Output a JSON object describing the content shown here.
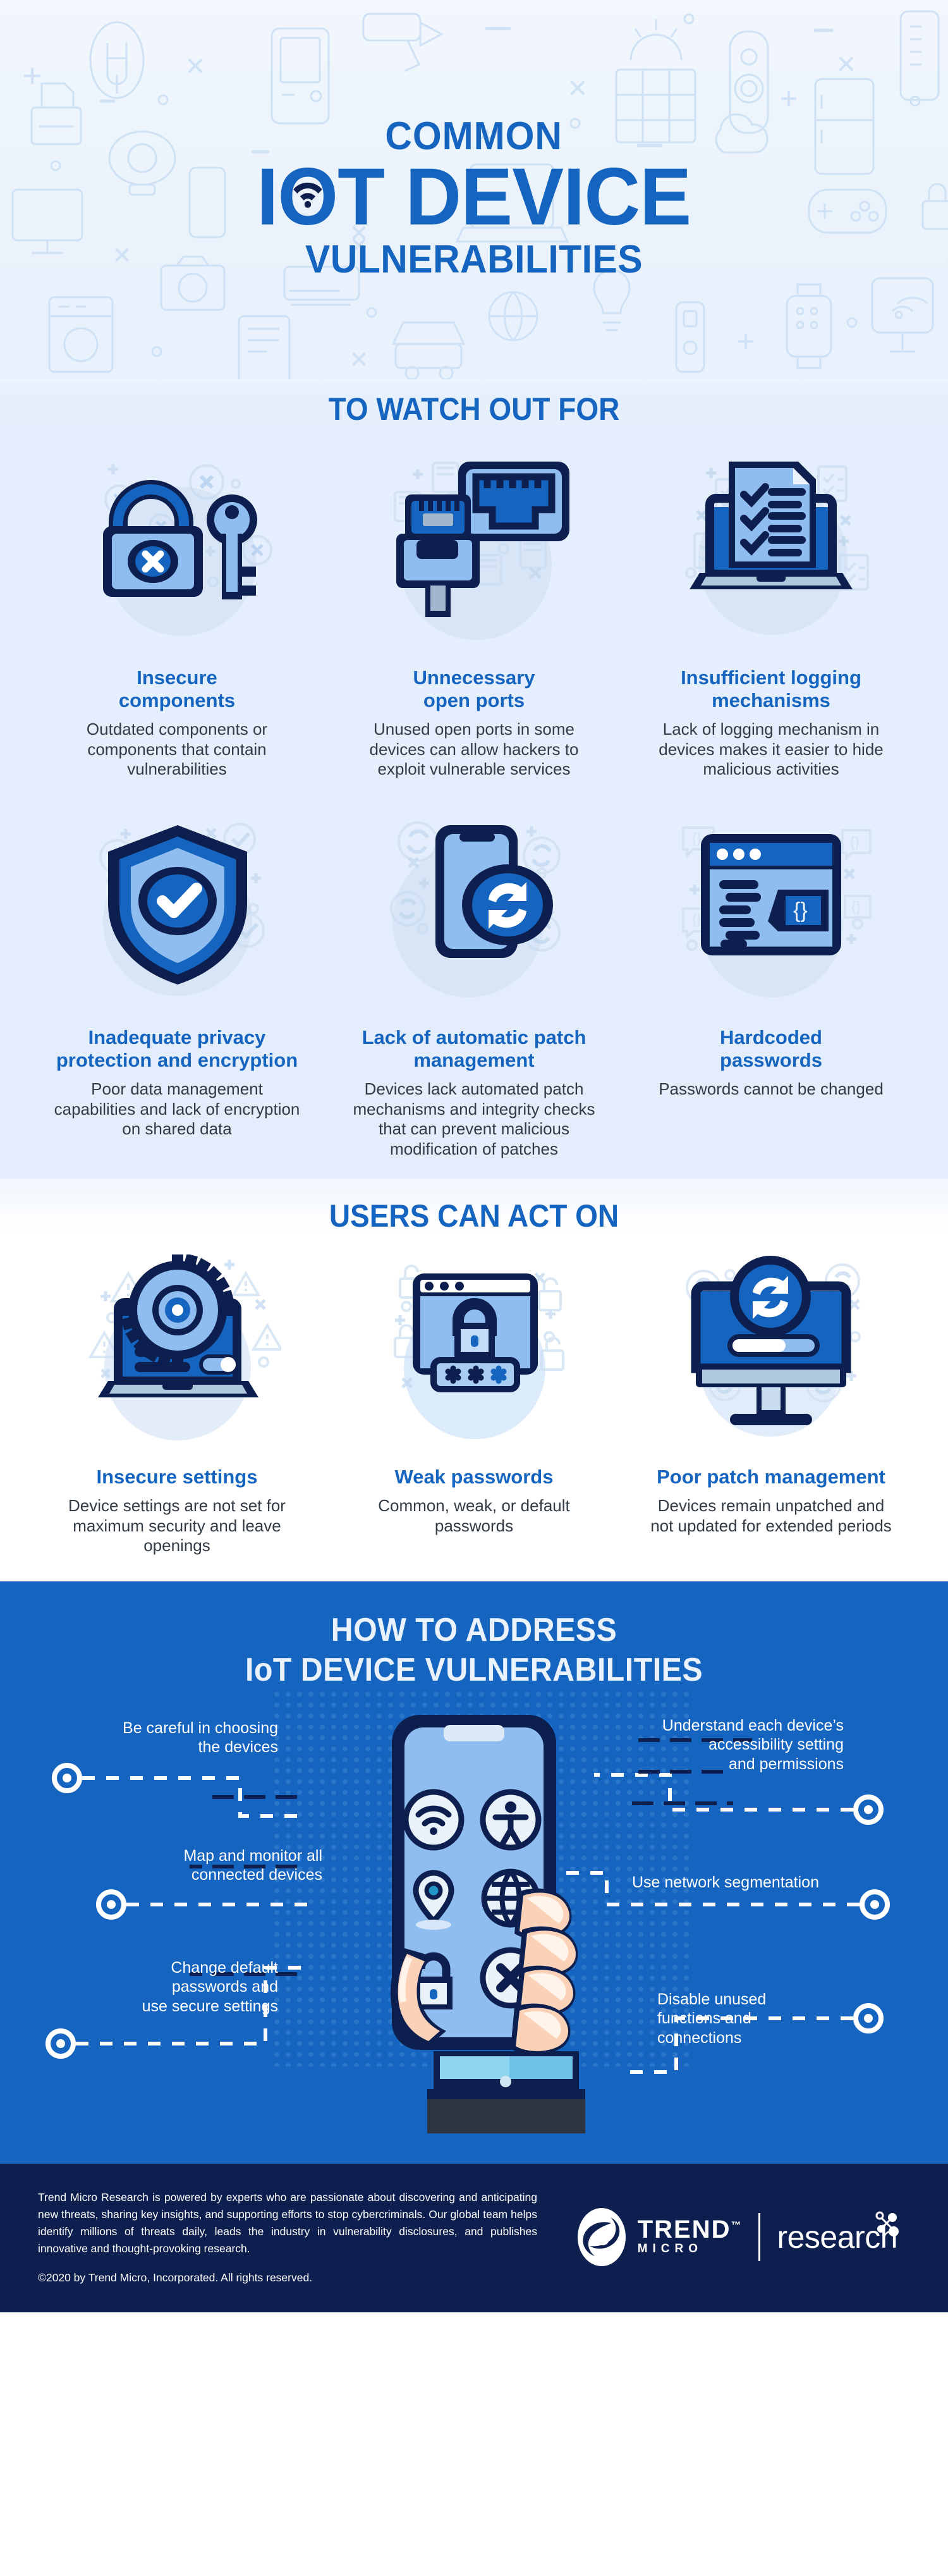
{
  "colors": {
    "brand_blue": "#1565c0",
    "navy": "#0d1f4e",
    "light_blue": "#8fbdef",
    "panel_bg": "#e5eefc",
    "footer_bg": "#0d1f4e"
  },
  "hero": {
    "kicker": "COMMON",
    "title_part1": "I",
    "title_o": "O",
    "title_part2": "T DEVICE",
    "title_plain": "IoT DEVICE",
    "subtitle": "VULNERABILITIES",
    "wifi_icon": "wifi-icon"
  },
  "sections": [
    {
      "id": "watch-out-for",
      "heading": "TO WATCH OUT FOR",
      "items": [
        {
          "icon": "open-padlock-and-key-icon",
          "title": "Insecure\ncomponents",
          "title_line1": "Insecure",
          "title_line2": "components",
          "desc": "Outdated components or components that contain vulnerabilities"
        },
        {
          "icon": "ethernet-port-plug-icon",
          "title_line1": "Unnecessary",
          "title_line2": "open ports",
          "desc": "Unused open ports in some devices can allow hackers to exploit vulnerable services"
        },
        {
          "icon": "laptop-checklist-document-icon",
          "title_line1": "Insufficient logging",
          "title_line2": "mechanisms",
          "desc": "Lack of logging mechanism in devices makes it easier to hide malicious activities"
        },
        {
          "icon": "shield-check-icon",
          "title_line1": "Inadequate privacy",
          "title_line2": "protection and encryption",
          "desc": "Poor data management capabilities and lack of encryption on shared data"
        },
        {
          "icon": "smartphone-sync-icon",
          "title_line1": "Lack of automatic patch",
          "title_line2": "management",
          "desc": "Devices lack automated patch mechanisms and integrity checks that can prevent malicious modification of patches"
        },
        {
          "icon": "code-browser-window-icon",
          "title_line1": "Hardcoded",
          "title_line2": "passwords",
          "desc": "Passwords cannot be changed"
        }
      ]
    },
    {
      "id": "users-can-act-on",
      "heading": "USERS CAN ACT ON",
      "items": [
        {
          "icon": "laptop-gear-settings-icon",
          "title_line1": "Insecure settings",
          "title_line2": "",
          "desc": "Device settings are not set for maximum security and leave openings"
        },
        {
          "icon": "browser-padlock-password-icon",
          "title_line1": "Weak passwords",
          "title_line2": "",
          "desc": "Common, weak, or default passwords"
        },
        {
          "icon": "monitor-update-progress-icon",
          "title_line1": "Poor patch management",
          "title_line2": "",
          "desc": "Devices remain unpatched and not updated for extended periods"
        }
      ]
    }
  ],
  "address": {
    "heading_line1": "HOW TO ADDRESS",
    "heading_line2": "IoT DEVICE VULNERABILITIES",
    "phone_icons": [
      "wifi-icon",
      "accessibility-icon",
      "location-pin-icon",
      "globe-icon",
      "padlock-icon",
      "x-circle-icon"
    ],
    "callouts_left": [
      {
        "text": "Be careful in choosing the devices",
        "line1": "Be careful in choosing",
        "line2": "the devices"
      },
      {
        "text": "Map and monitor all connected devices",
        "line1": "Map and monitor all",
        "line2": "connected devices"
      },
      {
        "text": "Change default passwords and use secure settings",
        "line1": "Change default",
        "line2": "passwords and",
        "line3": "use secure settings"
      }
    ],
    "callouts_right": [
      {
        "text": "Understand each device's accessibility setting and permissions",
        "line1": "Understand each device’s",
        "line2": "accessibility setting",
        "line3": "and permissions"
      },
      {
        "text": "Use network segmentation",
        "line1": "Use network segmentation",
        "line2": ""
      },
      {
        "text": "Disable unused functions and connections",
        "line1": "Disable unused",
        "line2": "functions and",
        "line3": "connections"
      }
    ]
  },
  "footer": {
    "paragraph": "Trend Micro Research is powered by experts who are passionate about discovering and anticipating new threats, sharing key insights, and supporting efforts to stop cybercriminals. Our global team helps identify millions of threats daily, leads the industry in vulnerability disclosures, and publishes innovative and thought-provoking research.",
    "copyright": "©2020 by Trend Micro, Incorporated. All rights reserved.",
    "brand_name": "TREND",
    "brand_sub": "MICRO",
    "brand_tm": "™",
    "research_label": "research"
  }
}
